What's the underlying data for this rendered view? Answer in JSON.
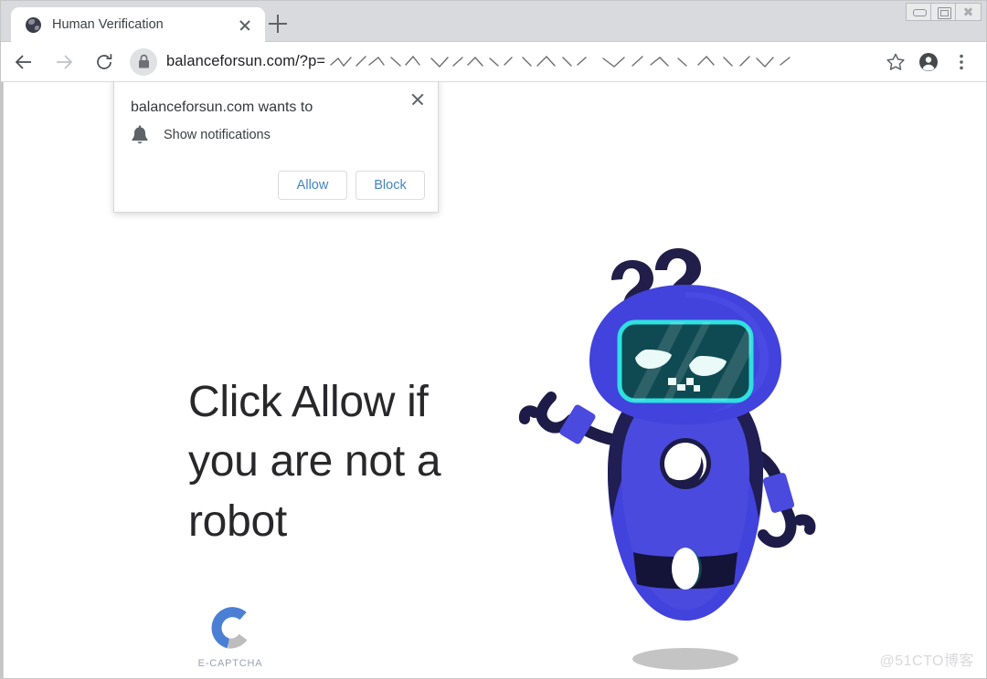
{
  "window": {
    "controls": {
      "minimize_label": "–",
      "maximize_label": "□",
      "close_label": "✕"
    }
  },
  "tabs": [
    {
      "title": "Human Verification",
      "favicon": "globe-icon",
      "close_label": "✕",
      "active": true
    }
  ],
  "new_tab": {
    "label": "+"
  },
  "toolbar": {
    "back": "back-arrow-icon",
    "forward": "forward-arrow-icon",
    "reload": "reload-icon",
    "lock": "lock-icon",
    "url_visible": "balanceforsun.com/?p=",
    "url_obscured_note": "scribbled-characters",
    "bookmark": "star-icon",
    "profile": "account-avatar-icon",
    "menu": "three-dot-menu-icon"
  },
  "permission_dialog": {
    "title": "balanceforsun.com wants to",
    "icon": "bell-icon",
    "request_label": "Show notifications",
    "allow_label": "Allow",
    "block_label": "Block",
    "close_label": "✕"
  },
  "page": {
    "headline": "Click Allow if you are not a robot",
    "captcha": {
      "brand": "E-CAPTCHA",
      "mark": "c-arc-logo",
      "arc_blue": "#4a7fd4",
      "arc_grey": "#bdbdbd"
    },
    "robot": {
      "name": "confused-robot-illustration",
      "thought": "??",
      "body_color": "#4242dd",
      "dark_color": "#1d1b47",
      "screen_color": "#0f4a52",
      "accent_color": "#2ee0e0"
    }
  },
  "watermark": {
    "text": "@51CTO博客",
    "color": "#d8d9db"
  }
}
